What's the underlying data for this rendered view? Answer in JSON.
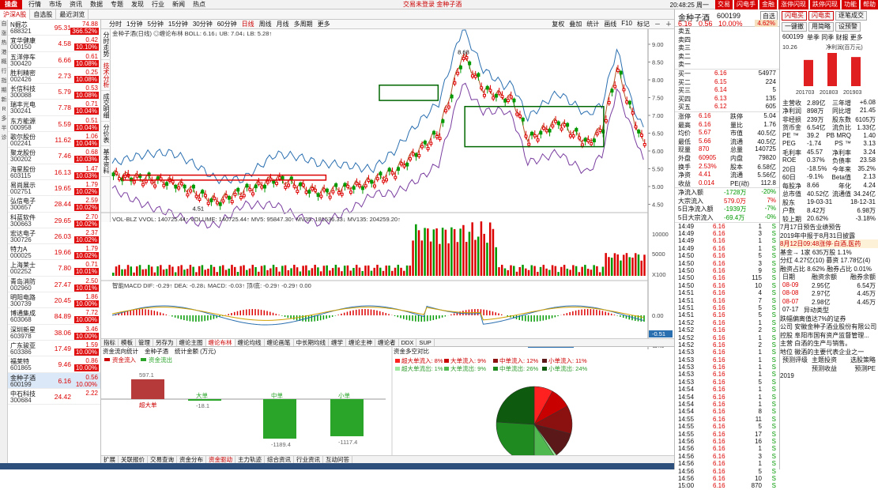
{
  "window": {
    "brand": "操盘",
    "menu": [
      "行情",
      "市场",
      "资讯",
      "数据",
      "专题",
      "发现",
      "行业",
      "新闻",
      "热点"
    ],
    "center_text": "交易未登录    金种子酒",
    "clock": "20:48:25 周一",
    "right_buttons": [
      "交易",
      "闪电手",
      "金融",
      "涨停闪现",
      "跌停闪现",
      "功能",
      "帮助"
    ]
  },
  "left_tabs": [
    "沪深A股",
    "自选股",
    "最近浏览"
  ],
  "icon_column": [
    "自",
    "涨",
    "热",
    "港",
    "概",
    "行",
    "指",
    "期",
    "新",
    "R",
    "多",
    "半",
    "诊"
  ],
  "stocks": [
    {
      "name": "N掘芯",
      "code": "688321",
      "price": "95.31",
      "change": "74.88",
      "pct": "366.52%"
    },
    {
      "name": "宜华健康",
      "code": "000150",
      "price": "4.58",
      "change": "0.42",
      "pct": "10.10%"
    },
    {
      "name": "五洋停车",
      "code": "300420",
      "price": "6.66",
      "change": "0.61",
      "pct": "10.08%"
    },
    {
      "name": "胜利精密",
      "code": "002426",
      "price": "2.73",
      "change": "0.25",
      "pct": "10.08%"
    },
    {
      "name": "长信科技",
      "code": "300088",
      "price": "5.79",
      "change": "0.53",
      "pct": "10.08%"
    },
    {
      "name": "瑞丰光电",
      "code": "300241",
      "price": "7.78",
      "change": "0.71",
      "pct": "10.04%"
    },
    {
      "name": "东方能源",
      "code": "000958",
      "price": "5.59",
      "change": "0.51",
      "pct": "10.04%"
    },
    {
      "name": "歌尔股份",
      "code": "002241",
      "price": "11.62",
      "change": "1.06",
      "pct": "10.04%"
    },
    {
      "name": "聚龙股份",
      "code": "300202",
      "price": "7.46",
      "change": "0.68",
      "pct": "10.03%"
    },
    {
      "name": "海星股份",
      "code": "603115",
      "price": "16.13",
      "change": "1.47",
      "pct": "10.03%"
    },
    {
      "name": "易尚展示",
      "code": "002751",
      "price": "19.65",
      "change": "1.79",
      "pct": "10.02%"
    },
    {
      "name": "弘信电子",
      "code": "300657",
      "price": "28.44",
      "change": "2.59",
      "pct": "10.02%"
    },
    {
      "name": "科蓝软件",
      "code": "300663",
      "price": "29.65",
      "change": "2.70",
      "pct": "10.02%"
    },
    {
      "name": "宏达电子",
      "code": "300726",
      "price": "26.03",
      "change": "2.37",
      "pct": "10.02%"
    },
    {
      "name": "特力A",
      "code": "000025",
      "price": "19.66",
      "change": "1.79",
      "pct": "10.02%"
    },
    {
      "name": "上海莱士",
      "code": "002252",
      "price": "7.80",
      "change": "0.71",
      "pct": "10.01%"
    },
    {
      "name": "青岛消防",
      "code": "002960",
      "price": "27.47",
      "change": "2.50",
      "pct": "10.01%"
    },
    {
      "name": "明阳电路",
      "code": "300739",
      "price": "20.45",
      "change": "1.86",
      "pct": "10.00%"
    },
    {
      "name": "博通集成",
      "code": "603068",
      "price": "84.89",
      "change": "7.72",
      "pct": "10.00%"
    },
    {
      "name": "深圳新星",
      "code": "603978",
      "price": "38.06",
      "change": "3.46",
      "pct": "10.00%"
    },
    {
      "name": "广东骏亚",
      "code": "603386",
      "price": "17.49",
      "change": "1.59",
      "pct": "10.00%"
    },
    {
      "name": "福莱特",
      "code": "601865",
      "price": "9.46",
      "change": "0.86",
      "pct": "10.00%"
    },
    {
      "name": "金种子酒",
      "code": "600199",
      "price": "6.16",
      "change": "0.56",
      "pct": "10.00%",
      "selected": true
    },
    {
      "name": "中石科技",
      "code": "300684",
      "price": "24.42",
      "change": "2.22",
      "pct": ""
    }
  ],
  "chart": {
    "tabs": [
      "分时",
      "1分钟",
      "5分钟",
      "15分钟",
      "30分钟",
      "60分钟",
      "日线",
      "周线",
      "月线",
      "多周期",
      "更多"
    ],
    "active_tab": "日线",
    "tools": [
      "复权",
      "叠加",
      "统计",
      "画线",
      "F10",
      "标记",
      "－",
      "＋"
    ],
    "side_tabs": [
      "分时走势",
      "技术分析",
      "成交明细",
      "分价表",
      "基本资料"
    ],
    "legend": "金种子酒(日线)  ◎缠论布林  BOLL: 6.16↓  UB: 7.04↓  LB: 5.28↑",
    "high_label": "8.68",
    "low_label": "4.51",
    "date_labels": [
      "2018年",
      "11",
      "12",
      "2019",
      "2",
      "3",
      "4",
      "5",
      "2019/05/13/一",
      "7",
      "8"
    ],
    "vol_legend": "VOL-BLZ  VVOL: 140725.44↑  VOLUME: 140725.44↑  MV5: 95847.30↑  MV35: 181536.33↓  MV135: 204259.20↑",
    "vol_axis": [
      "10000",
      "5000",
      "X100"
    ],
    "macd_legend": "智能MACD  DIF: -0.29↑  DEA: -0.28↓  MACD: -0.03↑  顶/底: -0.29↑  -0.29↑  0.00",
    "macd_axis": [
      "0.00",
      "-0.51"
    ],
    "bottom_tabs": [
      "指标",
      "模板",
      "管理",
      "另存为",
      "缠论主图",
      "缠论布林",
      "缠论均线",
      "缠论画笔",
      "中长期均线",
      "缠学",
      "缠论主神",
      "缠论者",
      "DDX",
      "SUP"
    ],
    "bottom_active": "缠论布林",
    "period_label": "日线"
  },
  "chart_data": {
    "type": "candlestick",
    "y_axis": [
      9.0,
      8.5,
      8.0,
      7.5,
      7.0,
      6.5,
      6.0,
      5.5,
      5.0,
      4.5
    ],
    "ylim": [
      4.4,
      9.2
    ],
    "boxes": [
      {
        "x0": 0.02,
        "x1": 0.4,
        "y0": 5.32,
        "y1": 5.18,
        "color": "#d00"
      },
      {
        "x0": 0.5,
        "x1": 0.61,
        "y0": 7.85,
        "y1": 7.42,
        "color": "#060"
      },
      {
        "x0": 0.66,
        "x1": 0.92,
        "y0": 7.25,
        "y1": 6.12,
        "color": "#060"
      }
    ]
  },
  "lower": {
    "left_header": [
      "资金流向统计",
      "金种子酒",
      "统计金额 (万元)"
    ],
    "left_legend": [
      "资金流入",
      "资金流出"
    ],
    "bars": [
      {
        "label": "超大单",
        "value": "597.1"
      },
      {
        "label": "大单",
        "value": "-18.1"
      },
      {
        "label": "中单",
        "value": "-1189.4"
      },
      {
        "label": "小单",
        "value": "-1117.4"
      }
    ],
    "right_header": "资金多空对比",
    "pie_legend": [
      "超大单流入: 8%",
      "大单流入: 9%",
      "中单流入: 12%",
      "小单流入: 11%",
      "超大单流出: 1%",
      "大单流出: 9%",
      "中单流出: 26%",
      "小单流出: 24%"
    ],
    "pie_values": [
      8,
      9,
      12,
      11,
      1,
      9,
      26,
      24
    ],
    "pie_colors": [
      "#ff2020",
      "#c80000",
      "#8b1010",
      "#5a1818",
      "#9fe89f",
      "#4fb84f",
      "#1f8a1f",
      "#0e5a0e"
    ]
  },
  "footer_tabs": [
    "扩展",
    "关联报价",
    "交易查询",
    "资金分布",
    "资金驱动",
    "主力轨迹",
    "综合资讯",
    "行业资讯",
    "互动问答"
  ],
  "footer_active": "资金驱动",
  "quote": {
    "name": "金种子酒",
    "code": "600199",
    "box": "自选",
    "price": "6.16",
    "delta": "0.56",
    "pct": "10.00%",
    "weibi": "4.62%",
    "sells": [
      [
        "卖五",
        "",
        ""
      ],
      [
        "卖四",
        "",
        ""
      ],
      [
        "卖三",
        "",
        ""
      ],
      [
        "卖二",
        "",
        ""
      ],
      [
        "卖一",
        "",
        ""
      ]
    ],
    "buys": [
      [
        "买一",
        "6.16",
        "54977"
      ],
      [
        "买二",
        "6.15",
        "224"
      ],
      [
        "买三",
        "6.14",
        "5"
      ],
      [
        "买四",
        "6.13",
        "135"
      ],
      [
        "买五",
        "6.12",
        "605"
      ]
    ],
    "stats": [
      [
        "涨停",
        "6.16",
        "跌停",
        "5.04"
      ],
      [
        "最高",
        "6.16",
        "量比",
        "1.76"
      ],
      [
        "均价",
        "5.67",
        "市值",
        "40.5亿"
      ],
      [
        "最低",
        "5.66",
        "流通",
        "40.5亿"
      ],
      [
        "现量",
        "870",
        "总量",
        "140725"
      ],
      [
        "外盘",
        "60905",
        "内盘",
        "79820"
      ],
      [
        "换手",
        "2.53%",
        "股本",
        "6.58亿"
      ],
      [
        "净资",
        "4.41",
        "流通",
        "5.56亿"
      ],
      [
        "收益",
        "0.014",
        "PE(动)",
        "112.8"
      ]
    ],
    "flows": [
      [
        "净流入额",
        "-1728万",
        "-20%"
      ],
      [
        "大宗流入",
        "579.0万",
        "7%"
      ],
      [
        "5日净流入额",
        "-1939万",
        "-7%"
      ],
      [
        "5日大宗流入",
        "-69.4万",
        "-0%"
      ]
    ],
    "ticks": [
      [
        "14:49",
        "6.16",
        "1",
        "S"
      ],
      [
        "14:49",
        "6.16",
        "3",
        "S"
      ],
      [
        "14:49",
        "6.16",
        "1",
        "S"
      ],
      [
        "14:49",
        "6.16",
        "1",
        "S"
      ],
      [
        "14:50",
        "6.16",
        "5",
        "S"
      ],
      [
        "14:50",
        "6.16",
        "3",
        "S"
      ],
      [
        "14:50",
        "6.16",
        "9",
        "S"
      ],
      [
        "14:50",
        "6.16",
        "115",
        "S"
      ],
      [
        "14:50",
        "6.16",
        "10",
        "S"
      ],
      [
        "14:51",
        "6.16",
        "4",
        "S"
      ],
      [
        "14:51",
        "6.16",
        "7",
        "S"
      ],
      [
        "14:51",
        "6.16",
        "5",
        "S"
      ],
      [
        "14:51",
        "6.16",
        "5",
        "S"
      ],
      [
        "14:52",
        "6.16",
        "1",
        "S"
      ],
      [
        "14:52",
        "6.16",
        "2",
        "S"
      ],
      [
        "14:52",
        "6.16",
        "1",
        "S"
      ],
      [
        "14:52",
        "6.16",
        "2",
        "S"
      ],
      [
        "14:53",
        "6.16",
        "1",
        "S"
      ],
      [
        "14:53",
        "6.16",
        "1",
        "S"
      ],
      [
        "14:53",
        "6.16",
        "1",
        "S"
      ],
      [
        "14:53",
        "6.16",
        "1",
        "S"
      ],
      [
        "14:53",
        "6.16",
        "5",
        "S"
      ],
      [
        "14:54",
        "6.16",
        "1",
        "S"
      ],
      [
        "14:54",
        "6.16",
        "1",
        "S"
      ],
      [
        "14:54",
        "6.16",
        "1",
        "S"
      ],
      [
        "14:54",
        "6.16",
        "8",
        "S"
      ],
      [
        "14:55",
        "6.16",
        "11",
        "S"
      ],
      [
        "14:55",
        "6.16",
        "5",
        "S"
      ],
      [
        "14:55",
        "6.16",
        "17",
        "S"
      ],
      [
        "14:56",
        "6.16",
        "16",
        "S"
      ],
      [
        "14:56",
        "6.16",
        "1",
        "S"
      ],
      [
        "14:56",
        "6.16",
        "3",
        "S"
      ],
      [
        "14:56",
        "6.16",
        "1",
        "S"
      ],
      [
        "14:56",
        "6.16",
        "5",
        "S"
      ],
      [
        "14:56",
        "6.16",
        "10",
        "S"
      ],
      [
        "15:00",
        "6.16",
        "870",
        "S"
      ]
    ]
  },
  "f10": {
    "buttons": [
      "闪电买",
      "闪电卖",
      "逐笔成交",
      "一键撤",
      "用简略",
      "设预警"
    ],
    "code": "600199",
    "tabs": [
      "单季",
      "同季",
      "财报",
      "更多"
    ],
    "left_val_label": "10.26",
    "right_val_label": "净利润(百万元)",
    "mini_years": [
      "201703",
      "201803",
      "201903"
    ],
    "mini_values": [
      8.1,
      10.26,
      9.0
    ],
    "rows": [
      [
        "主营收",
        "2.89亿",
        "三年增",
        "+6.08"
      ],
      [
        "净利润",
        "898万",
        "同比增",
        "21.45"
      ],
      [
        "非经损",
        "239万",
        "股东数",
        "6105万"
      ],
      [
        "货币金",
        "6.54亿",
        "流负比",
        "1.33亿"
      ],
      [
        "PE ™",
        "39.2",
        "PB MRQ",
        "1.40"
      ],
      [
        "PEG",
        "-1.74",
        "PS ™",
        "3.13"
      ],
      [
        "毛利率",
        "45.57",
        "净利率",
        "3.24"
      ],
      [
        "ROE",
        "0.37%",
        "负债率",
        "23.58"
      ],
      [
        "20日",
        "-18.5%",
        "今年来",
        "35.2%"
      ],
      [
        "60日",
        "-9.1%",
        "Beta值",
        "2.13"
      ],
      [
        "每股净",
        "8.66",
        "年化",
        "4.24"
      ],
      [
        "总市值",
        "40.52亿",
        "流通值",
        "34.24亿"
      ],
      [
        "股东",
        "19-03-31",
        "",
        "18-12-31"
      ],
      [
        "户数",
        "8.42万",
        "",
        "6.98万"
      ],
      [
        "较上期",
        "20.62%",
        "",
        "-3.18%"
      ]
    ],
    "news": [
      "7月17日预告业绩预告",
      "2019年中报于8月31日披露"
    ],
    "hl": "8月12日09:48涨停·白酒,医药",
    "extra": [
      "基金→ 1家   635万股  1.1%",
      "分红 4.27亿(10) 募资 17.78亿(4)",
      "融资占比 8.62% 融券占比 0.01%"
    ],
    "margin_header": [
      "日期",
      "融资余额",
      "融券余额"
    ],
    "margin": [
      [
        "08-09",
        "2.95亿",
        "6.54万"
      ],
      [
        "08-08",
        "2.97亿",
        "4.45万"
      ],
      [
        "08-07",
        "2.98亿",
        "4.45万"
      ]
    ],
    "event": [
      "07-17",
      "异动类型",
      "跌幅偏离值达7%的证券"
    ],
    "company": [
      "公司 安徽金种子酒业股份有限公司",
      "控股 阜阳市国有资产监督管理...",
      "主营 白酒的生产与销售。",
      "地位 徽酒的主要代表企业之一"
    ],
    "footer_tabs": [
      "预测评级",
      "主题投资",
      "选股策略"
    ],
    "footer_row": [
      "预测收益",
      "预测PE"
    ],
    "footer_year": "2019"
  }
}
